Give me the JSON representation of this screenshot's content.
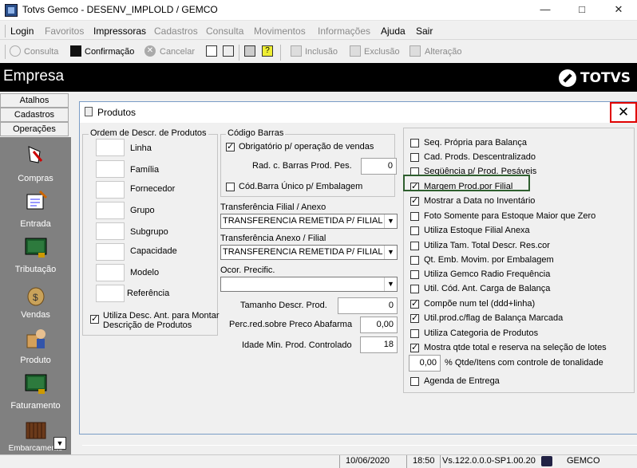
{
  "window": {
    "title": "Totvs Gemco - DESENV_IMPLOLD / GEMCO"
  },
  "menu": [
    "Login",
    "Favoritos",
    "Impressoras",
    "Cadastros",
    "Consulta",
    "Movimentos",
    "Informações",
    "Ajuda",
    "Sair"
  ],
  "toolbar": {
    "consulta": "Consulta",
    "confirmacao": "Confirmação",
    "cancelar": "Cancelar",
    "inclusao": "Inclusão",
    "exclusao": "Exclusão",
    "alteracao": "Alteração"
  },
  "header": {
    "title": "Empresa",
    "logo": "TOTVS"
  },
  "sidebar": {
    "tabs": [
      "Atalhos",
      "Cadastros",
      "Operações"
    ],
    "items": [
      "Compras",
      "Entrada",
      "Tributação",
      "Vendas",
      "Produto",
      "Faturamento",
      "Embarcamento"
    ]
  },
  "dialog": {
    "title": "Produtos",
    "close": "✕",
    "ordem": {
      "title": "Ordem de Descr. de Produtos",
      "fields": [
        "Linha",
        "Família",
        "Fornecedor",
        "Grupo",
        "Subgrupo",
        "Capacidade",
        "Modelo",
        "Referência"
      ],
      "utiliza_desc_line1": "Utiliza Desc. Ant. para Montar",
      "utiliza_desc_line2": "Descrição de Produtos"
    },
    "codigo_barras": {
      "title": "Código Barras",
      "obrigatorio": "Obrigatório p/ operação de vendas",
      "rad_label": "Rad. c. Barras Prod. Pes.",
      "rad_value": "0",
      "cod_unico": "Cód.Barra Único p/ Embalagem"
    },
    "transf_filial": {
      "label": "Transferência Filial / Anexo",
      "value": "TRANSFERENCIA REMETIDA P/ FILIAL"
    },
    "transf_anexo": {
      "label": "Transferência Anexo / Filial",
      "value": "TRANSFERENCIA REMETIDA P/ FILIAL"
    },
    "ocor": {
      "label": "Ocor. Precific.",
      "value": ""
    },
    "tamanho": {
      "label": "Tamanho Descr. Prod.",
      "value": "0"
    },
    "perc": {
      "label": "Perc.red.sobre Preco Abafarma",
      "value": "0,00"
    },
    "idade": {
      "label": "Idade Min. Prod. Controlado",
      "value": "18"
    },
    "options": [
      {
        "label": "Seq. Própria para Balança",
        "checked": false
      },
      {
        "label": "Cad. Prods. Descentralizado",
        "checked": false
      },
      {
        "label": "Seqüência p/ Prod. Pesáveis",
        "checked": false
      },
      {
        "label": "Margem Prod.por Filial",
        "checked": true
      },
      {
        "label": "Mostrar a Data no Inventário",
        "checked": true
      },
      {
        "label": "Foto Somente para Estoque Maior que Zero",
        "checked": false
      },
      {
        "label": "Utiliza Estoque Filial Anexa",
        "checked": false
      },
      {
        "label": "Utiliza Tam. Total  Descr. Res.cor",
        "checked": false
      },
      {
        "label": "Qt. Emb. Movim. por Embalagem",
        "checked": false
      },
      {
        "label": "Utiliza Gemco Radio Frequência",
        "checked": false
      },
      {
        "label": "Util. Cód. Ant. Carga de Balança",
        "checked": false
      },
      {
        "label": "Compõe num tel (ddd+linha)",
        "checked": true
      },
      {
        "label": "Util.prod.c/flag de Balança Marcada",
        "checked": true
      },
      {
        "label": "Utiliza Categoria de Produtos",
        "checked": false
      },
      {
        "label": "Mostra qtde total e reserva na seleção de lotes",
        "checked": true
      }
    ],
    "pct_value": "0,00",
    "pct_label": "% Qtde/Itens com controle de tonalidade",
    "agenda": {
      "label": "Agenda de Entrega",
      "checked": false
    }
  },
  "status": {
    "date": "10/06/2020",
    "time": "18:50",
    "version": "Vs.122.0.0.0-SP1.00.20",
    "user": "GEMCO"
  }
}
